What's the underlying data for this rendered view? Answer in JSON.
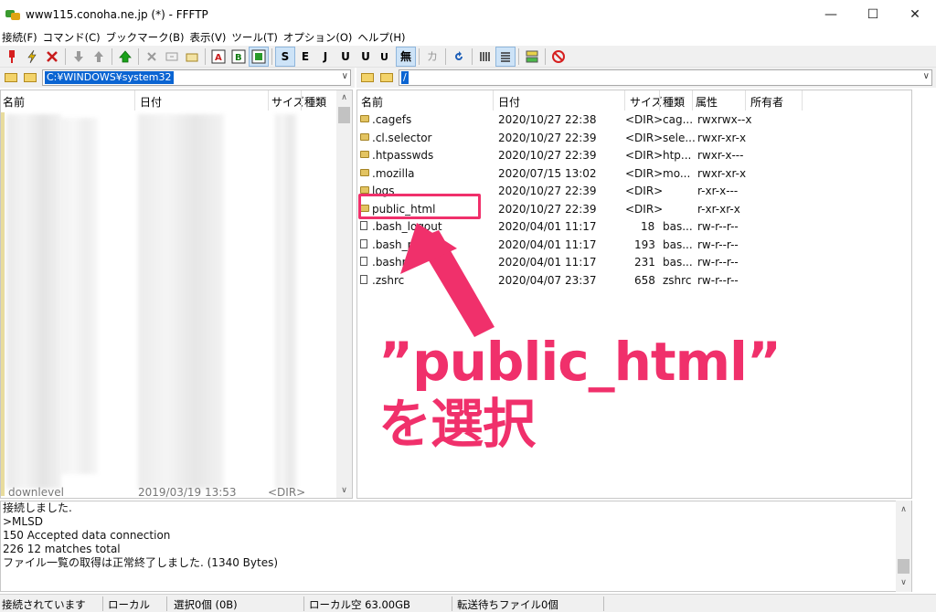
{
  "window": {
    "title": "www115.conoha.ne.jp (*) - FFFTP",
    "minimize": "—",
    "maximize": "☐",
    "close": "✕"
  },
  "menu": [
    "接続(F)",
    "コマンド(C)",
    "ブックマーク(B)",
    "表示(V)",
    "ツール(T)",
    "オプション(O)",
    "ヘルプ(H)"
  ],
  "toolbar": {
    "labels": [
      "S",
      "E",
      "J",
      "U",
      "U",
      "無",
      "カ"
    ]
  },
  "local": {
    "path": "C:¥WINDOWS¥system32",
    "headers": {
      "name": "名前",
      "date": "日付",
      "size": "サイズ",
      "type": "種類"
    },
    "last_row_partial": {
      "name": "downlevel",
      "date": "2019/03/19 13:53",
      "size": "<DIR>"
    }
  },
  "remote": {
    "path": "/",
    "headers": {
      "name": "名前",
      "date": "日付",
      "size": "サイズ",
      "type": "種類",
      "perm": "属性",
      "owner": "所有者"
    },
    "rows": [
      {
        "kind": "folder",
        "name": ".cagefs",
        "date": "2020/10/27 22:38",
        "size": "<DIR>",
        "type": "cag...",
        "perm": "rwxrwx--x"
      },
      {
        "kind": "folder",
        "name": ".cl.selector",
        "date": "2020/10/27 22:39",
        "size": "<DIR>",
        "type": "sele...",
        "perm": "rwxr-xr-x"
      },
      {
        "kind": "folder",
        "name": ".htpasswds",
        "date": "2020/10/27 22:39",
        "size": "<DIR>",
        "type": "htp...",
        "perm": "rwxr-x---"
      },
      {
        "kind": "folder",
        "name": ".mozilla",
        "date": "2020/07/15 13:02",
        "size": "<DIR>",
        "type": "mo...",
        "perm": "rwxr-xr-x"
      },
      {
        "kind": "folder",
        "name": "logs",
        "date": "2020/10/27 22:39",
        "size": "<DIR>",
        "type": "",
        "perm": "r-xr-x---"
      },
      {
        "kind": "folder",
        "name": "public_html",
        "date": "2020/10/27 22:39",
        "size": "<DIR>",
        "type": "",
        "perm": "r-xr-xr-x"
      },
      {
        "kind": "file",
        "name": ".bash_logout",
        "date": "2020/04/01 11:17",
        "size": "18",
        "type": "bas...",
        "perm": "rw-r--r--"
      },
      {
        "kind": "file",
        "name": ".bash_profile",
        "date": "2020/04/01 11:17",
        "size": "193",
        "type": "bas...",
        "perm": "rw-r--r--"
      },
      {
        "kind": "file",
        "name": ".bashrc",
        "date": "2020/04/01 11:17",
        "size": "231",
        "type": "bas...",
        "perm": "rw-r--r--"
      },
      {
        "kind": "file",
        "name": ".zshrc",
        "date": "2020/04/07 23:37",
        "size": "658",
        "type": "zshrc",
        "perm": "rw-r--r--"
      }
    ]
  },
  "log": [
    "接続しました.",
    ">MLSD",
    "150 Accepted data connection",
    "226 12 matches total",
    "ファイル一覧の取得は正常終了しました. (1340 Bytes)"
  ],
  "status": {
    "connection": "接続されています",
    "side": "ローカル",
    "selection": "選択0個 (0B)",
    "local_free": "ローカル空 63.00GB",
    "queue": "転送待ちファイル0個"
  },
  "annotation": {
    "line1": "”public_html”",
    "line2": "を選択",
    "color": "#f0306b"
  }
}
